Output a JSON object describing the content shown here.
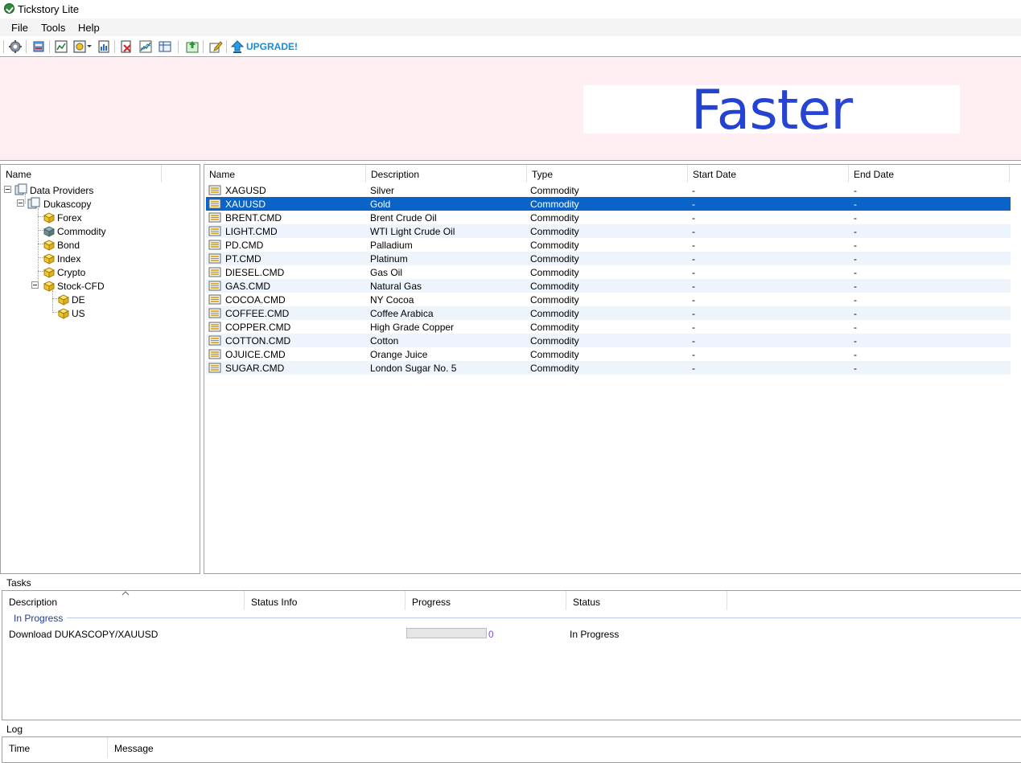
{
  "window": {
    "title": "Tickstory Lite"
  },
  "menu": [
    "File",
    "Tools",
    "Help"
  ],
  "toolbar": {
    "upgrade_label": "UPGRADE!",
    "icons": [
      "settings-icon",
      "export-icon",
      "chart-window-icon",
      "chart-options-icon",
      "report-icon",
      "delete-data-icon",
      "line-chart-icon",
      "table-chart-icon",
      "download-icon",
      "edit-icon",
      "upgrade-arrow-icon"
    ]
  },
  "banner": {
    "ad_text": "Faster"
  },
  "tree": {
    "header": "Name",
    "nodes": [
      {
        "label": "Data Providers"
      },
      {
        "label": "Dukascopy"
      },
      {
        "label": "Forex"
      },
      {
        "label": "Commodity"
      },
      {
        "label": "Bond"
      },
      {
        "label": "Index"
      },
      {
        "label": "Crypto"
      },
      {
        "label": "Stock-CFD"
      },
      {
        "label": "DE"
      },
      {
        "label": "US"
      }
    ]
  },
  "grid": {
    "columns": [
      "Name",
      "Description",
      "Type",
      "Start Date",
      "End Date"
    ],
    "rows": [
      {
        "name": "XAGUSD",
        "description": "Silver",
        "type": "Commodity",
        "start": "-",
        "end": "-"
      },
      {
        "name": "XAUUSD",
        "description": "Gold",
        "type": "Commodity",
        "start": "-",
        "end": "-"
      },
      {
        "name": "BRENT.CMD",
        "description": "Brent Crude Oil",
        "type": "Commodity",
        "start": "-",
        "end": "-"
      },
      {
        "name": "LIGHT.CMD",
        "description": "WTI Light Crude Oil",
        "type": "Commodity",
        "start": "-",
        "end": "-"
      },
      {
        "name": "PD.CMD",
        "description": "Palladium",
        "type": "Commodity",
        "start": "-",
        "end": "-"
      },
      {
        "name": "PT.CMD",
        "description": "Platinum",
        "type": "Commodity",
        "start": "-",
        "end": "-"
      },
      {
        "name": "DIESEL.CMD",
        "description": "Gas Oil",
        "type": "Commodity",
        "start": "-",
        "end": "-"
      },
      {
        "name": "GAS.CMD",
        "description": "Natural Gas",
        "type": "Commodity",
        "start": "-",
        "end": "-"
      },
      {
        "name": "COCOA.CMD",
        "description": "NY Cocoa",
        "type": "Commodity",
        "start": "-",
        "end": "-"
      },
      {
        "name": "COFFEE.CMD",
        "description": "Coffee Arabica",
        "type": "Commodity",
        "start": "-",
        "end": "-"
      },
      {
        "name": "COPPER.CMD",
        "description": "High Grade Copper",
        "type": "Commodity",
        "start": "-",
        "end": "-"
      },
      {
        "name": "COTTON.CMD",
        "description": "Cotton",
        "type": "Commodity",
        "start": "-",
        "end": "-"
      },
      {
        "name": "OJUICE.CMD",
        "description": "Orange Juice",
        "type": "Commodity",
        "start": "-",
        "end": "-"
      },
      {
        "name": "SUGAR.CMD",
        "description": "London Sugar No. 5",
        "type": "Commodity",
        "start": "-",
        "end": "-"
      }
    ],
    "selected_row": 1
  },
  "tasks": {
    "label": "Tasks",
    "columns": [
      "Description",
      "Status Info",
      "Progress",
      "Status"
    ],
    "group": "In Progress",
    "items": [
      {
        "description": "Download DUKASCOPY/XAUUSD",
        "status_info": "",
        "progress": 0,
        "progress_text": "0",
        "status": "In Progress"
      }
    ]
  },
  "log": {
    "label": "Log",
    "columns": [
      "Time",
      "Message"
    ]
  },
  "colors": {
    "selection": "#0a64c8",
    "banner_bg": "#ffeef2",
    "upgrade_text": "#1b8bd6",
    "ad_text": "#2a45d4"
  }
}
